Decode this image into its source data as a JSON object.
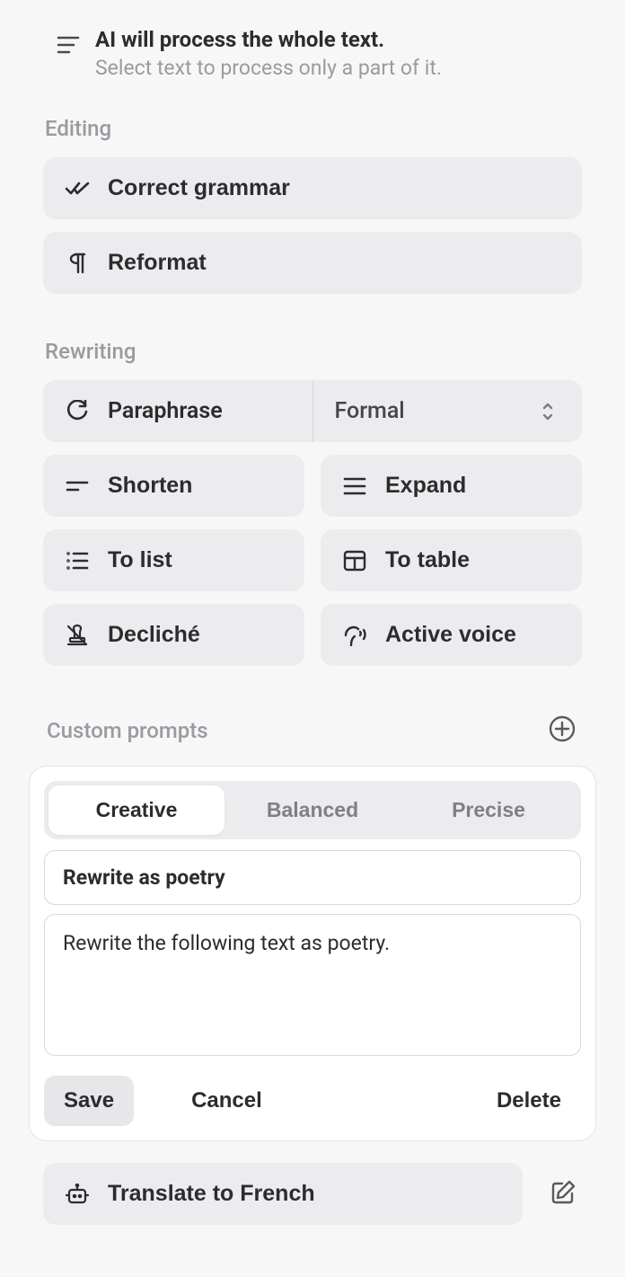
{
  "header": {
    "title": "AI will process the whole text.",
    "subtitle": "Select text to process only a part of it."
  },
  "editing": {
    "label": "Editing",
    "correct_grammar": "Correct grammar",
    "reformat": "Reformat"
  },
  "rewriting": {
    "label": "Rewriting",
    "paraphrase": "Paraphrase",
    "tone_selected": "Formal",
    "shorten": "Shorten",
    "expand": "Expand",
    "to_list": "To list",
    "to_table": "To table",
    "decliche": "Decliché",
    "active_voice": "Active voice"
  },
  "custom": {
    "label": "Custom prompts",
    "tabs": {
      "creative": "Creative",
      "balanced": "Balanced",
      "precise": "Precise"
    },
    "prompt_name": "Rewrite as poetry",
    "prompt_text": "Rewrite the following text as poetry.",
    "save": "Save",
    "cancel": "Cancel",
    "delete": "Delete",
    "translate": "Translate to French"
  }
}
